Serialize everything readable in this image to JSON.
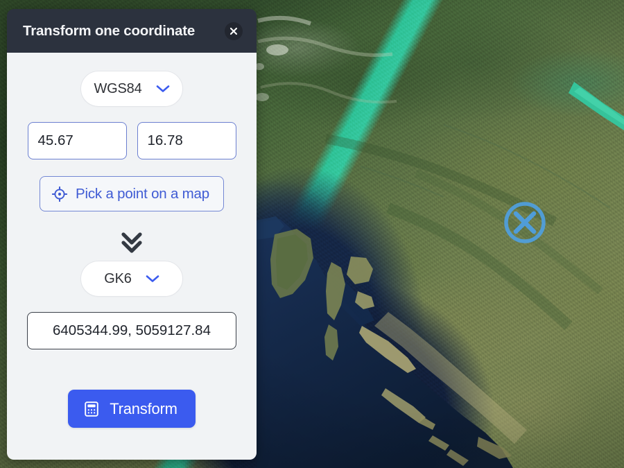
{
  "panel": {
    "title": "Transform one coordinate",
    "close_icon": "close-icon",
    "source": {
      "crs_selected": "WGS84",
      "chevron_icon": "chevron-down-icon",
      "latitude": "45.67",
      "longitude": "16.78",
      "latitude_placeholder": "",
      "longitude_placeholder": ""
    },
    "pick_point": {
      "label": "Pick a point on a map",
      "icon": "crosshair-icon"
    },
    "direction_icon": "double-chevron-down-icon",
    "target": {
      "crs_selected": "GK6",
      "chevron_icon": "chevron-down-icon",
      "result": "6405344.99, 5059127.84",
      "result_placeholder": ""
    },
    "transform": {
      "label": "Transform",
      "icon": "calculator-icon"
    }
  },
  "map": {
    "marker_icon": "circle-x-marker-icon",
    "basemap": "satellite"
  },
  "colors": {
    "header_bg": "#2c323e",
    "panel_bg": "#f1f3f5",
    "accent_blue": "#3b5bef",
    "link_blue": "#3f5bd4",
    "input_border": "#6b7fd0",
    "result_border": "#3a3f48",
    "marker_blue": "#4f9fe0",
    "text_dark": "#20242c"
  }
}
